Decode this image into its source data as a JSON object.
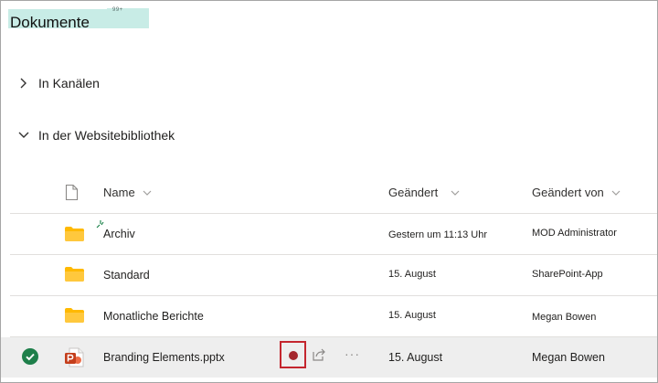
{
  "header": {
    "title": "Dokumente",
    "badge": "99+"
  },
  "sections": [
    {
      "label": "In Kanälen",
      "expanded": false
    },
    {
      "label": "In der Websitebibliothek",
      "expanded": true
    }
  ],
  "columns": {
    "name": "Name",
    "modified": "Geändert",
    "modified_by": "Geändert von"
  },
  "rows": [
    {
      "name": "Archiv",
      "modified": "Gestern um 11:13 Uhr",
      "modified_by": "MOD Administrator",
      "type": "folder",
      "new": true
    },
    {
      "name": "Standard",
      "modified": "15. August",
      "modified_by": "SharePoint-App",
      "type": "folder"
    },
    {
      "name": "Monatliche Berichte",
      "modified": "15. August",
      "modified_by": "Megan Bowen",
      "type": "folder"
    },
    {
      "name": "Branding Elements.pptx",
      "modified": "15. August",
      "modified_by": "Megan Bowen",
      "type": "pptx",
      "selected": true
    }
  ],
  "row_actions": {
    "more": "···"
  },
  "colors": {
    "title_highlight": "#c8ece6",
    "folder": "#ffb900",
    "powerpoint": "#c43e1c",
    "selected_check": "#1e7f4a",
    "sync_highlight": "#c4262e",
    "row_selected_bg": "#eeeeee"
  },
  "icons": {
    "file_header": "document-icon",
    "sort": "chevron-down-icon",
    "collapsed": "chevron-right-icon",
    "expanded": "chevron-down-icon",
    "folder": "folder-icon",
    "pptx": "powerpoint-icon",
    "check": "checkmark-circle-icon",
    "sync": "sync-status-icon",
    "share": "share-icon",
    "new": "new-item-sparkle-icon"
  }
}
